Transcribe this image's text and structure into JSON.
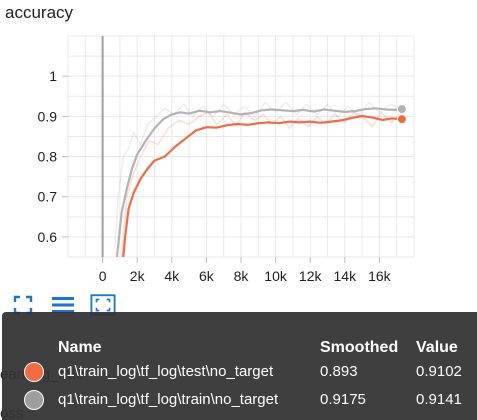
{
  "card": {
    "title": "accuracy"
  },
  "chart_data": {
    "type": "line",
    "title": "accuracy",
    "xlabel": "",
    "ylabel": "",
    "xlim": [
      -2000,
      18000
    ],
    "ylim": [
      0.55,
      1.1
    ],
    "x_ticks": [
      "0",
      "2k",
      "4k",
      "6k",
      "8k",
      "10k",
      "12k",
      "14k",
      "16k"
    ],
    "x_tick_values": [
      0,
      2000,
      4000,
      6000,
      8000,
      10000,
      12000,
      14000,
      16000
    ],
    "y_ticks": [
      "0.6",
      "0.7",
      "0.8",
      "0.9",
      "1"
    ],
    "y_tick_values": [
      0.6,
      0.7,
      0.8,
      0.9,
      1.0
    ],
    "grid": true,
    "series": [
      {
        "name": "q1\\train_log\\tf_log\\test\\no_target",
        "color": "#f26b43",
        "smoothed": [
          [
            1100,
            0.5
          ],
          [
            1300,
            0.6
          ],
          [
            1500,
            0.67
          ],
          [
            1800,
            0.71
          ],
          [
            2200,
            0.745
          ],
          [
            2600,
            0.77
          ],
          [
            3000,
            0.79
          ],
          [
            3600,
            0.8
          ],
          [
            4200,
            0.825
          ],
          [
            4800,
            0.845
          ],
          [
            5400,
            0.865
          ],
          [
            6000,
            0.873
          ],
          [
            6600,
            0.872
          ],
          [
            7200,
            0.878
          ],
          [
            7800,
            0.881
          ],
          [
            8400,
            0.879
          ],
          [
            9000,
            0.883
          ],
          [
            9600,
            0.885
          ],
          [
            10200,
            0.883
          ],
          [
            10800,
            0.887
          ],
          [
            11400,
            0.885
          ],
          [
            12000,
            0.887
          ],
          [
            12600,
            0.884
          ],
          [
            13200,
            0.887
          ],
          [
            13800,
            0.89
          ],
          [
            14400,
            0.896
          ],
          [
            15000,
            0.901
          ],
          [
            15600,
            0.897
          ],
          [
            16200,
            0.891
          ],
          [
            16700,
            0.895
          ],
          [
            17300,
            0.893
          ]
        ],
        "raw": [
          [
            1100,
            0.55
          ],
          [
            1400,
            0.7
          ],
          [
            1800,
            0.76
          ],
          [
            2200,
            0.8
          ],
          [
            2700,
            0.84
          ],
          [
            3200,
            0.83
          ],
          [
            3800,
            0.87
          ],
          [
            4400,
            0.89
          ],
          [
            5000,
            0.88
          ],
          [
            5600,
            0.9
          ],
          [
            6100,
            0.91
          ],
          [
            6600,
            0.88
          ],
          [
            7200,
            0.905
          ],
          [
            7700,
            0.875
          ],
          [
            8200,
            0.91
          ],
          [
            8800,
            0.89
          ],
          [
            9300,
            0.905
          ],
          [
            9800,
            0.88
          ],
          [
            10300,
            0.9
          ],
          [
            10800,
            0.87
          ],
          [
            11300,
            0.895
          ],
          [
            11900,
            0.875
          ],
          [
            12400,
            0.9
          ],
          [
            12900,
            0.88
          ],
          [
            13400,
            0.905
          ],
          [
            14000,
            0.885
          ],
          [
            14500,
            0.91
          ],
          [
            15100,
            0.895
          ],
          [
            15600,
            0.875
          ],
          [
            16100,
            0.91
          ],
          [
            16700,
            0.885
          ],
          [
            17300,
            0.91
          ]
        ],
        "last_point": [
          17300,
          0.893
        ]
      },
      {
        "name": "q1\\train_log\\tf_log\\train\\no_target",
        "color": "#b3b3b3",
        "smoothed": [
          [
            700,
            0.5
          ],
          [
            900,
            0.58
          ],
          [
            1100,
            0.66
          ],
          [
            1400,
            0.72
          ],
          [
            1700,
            0.77
          ],
          [
            2000,
            0.805
          ],
          [
            2500,
            0.84
          ],
          [
            3000,
            0.87
          ],
          [
            3500,
            0.893
          ],
          [
            4000,
            0.905
          ],
          [
            4500,
            0.91
          ],
          [
            5000,
            0.907
          ],
          [
            5600,
            0.914
          ],
          [
            6200,
            0.91
          ],
          [
            6800,
            0.913
          ],
          [
            7400,
            0.909
          ],
          [
            8000,
            0.905
          ],
          [
            8600,
            0.908
          ],
          [
            9200,
            0.915
          ],
          [
            9800,
            0.917
          ],
          [
            10400,
            0.915
          ],
          [
            11000,
            0.913
          ],
          [
            11600,
            0.916
          ],
          [
            12200,
            0.912
          ],
          [
            12800,
            0.917
          ],
          [
            13400,
            0.914
          ],
          [
            14000,
            0.911
          ],
          [
            14600,
            0.913
          ],
          [
            15200,
            0.918
          ],
          [
            15800,
            0.92
          ],
          [
            16400,
            0.917
          ],
          [
            16900,
            0.916
          ],
          [
            17300,
            0.918
          ]
        ],
        "raw": [
          [
            700,
            0.57
          ],
          [
            900,
            0.7
          ],
          [
            1200,
            0.8
          ],
          [
            1500,
            0.82
          ],
          [
            1800,
            0.86
          ],
          [
            2200,
            0.83
          ],
          [
            2600,
            0.88
          ],
          [
            3100,
            0.9
          ],
          [
            3600,
            0.92
          ],
          [
            4100,
            0.905
          ],
          [
            4700,
            0.93
          ],
          [
            5200,
            0.9
          ],
          [
            5800,
            0.925
          ],
          [
            6400,
            0.9
          ],
          [
            7000,
            0.93
          ],
          [
            7600,
            0.905
          ],
          [
            8200,
            0.925
          ],
          [
            8800,
            0.9
          ],
          [
            9400,
            0.935
          ],
          [
            10000,
            0.91
          ],
          [
            10600,
            0.935
          ],
          [
            11200,
            0.905
          ],
          [
            11800,
            0.93
          ],
          [
            12400,
            0.905
          ],
          [
            13000,
            0.93
          ],
          [
            13600,
            0.9
          ],
          [
            14200,
            0.925
          ],
          [
            14800,
            0.9
          ],
          [
            15400,
            0.935
          ],
          [
            16000,
            0.91
          ],
          [
            16600,
            0.93
          ],
          [
            17300,
            0.92
          ]
        ],
        "last_point": [
          17300,
          0.918
        ]
      }
    ]
  },
  "toolbar": {
    "icons": [
      "expand-icon",
      "toggle-y-log-icon",
      "fit-domain-icon"
    ],
    "accent_color": "#1976d2"
  },
  "behind_text": {
    "learning_rate_partial": "earning_rate",
    "loss_partial": "oss"
  },
  "tooltip": {
    "headers": {
      "name": "Name",
      "smoothed": "Smoothed",
      "value": "Value"
    },
    "rows": [
      {
        "name": "q1\\train_log\\tf_log\\test\\no_target",
        "smoothed": "0.893",
        "value": "0.9102",
        "color": "#f26b43"
      },
      {
        "name": "q1\\train_log\\tf_log\\train\\no_target",
        "smoothed": "0.9175",
        "value": "0.9141",
        "color": "#9e9e9e"
      }
    ]
  }
}
